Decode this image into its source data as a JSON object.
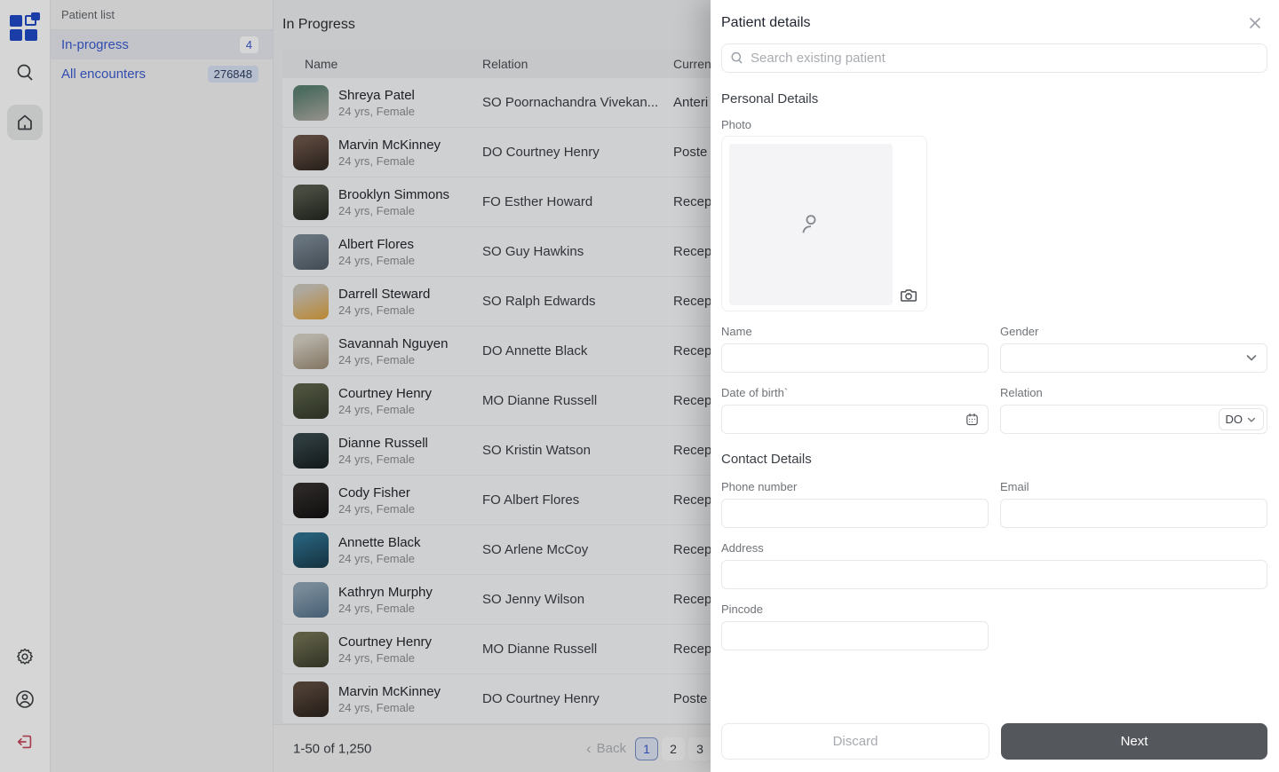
{
  "colors": {
    "accent_blue": "#3b5bd0",
    "logo_blue": "#2149c8",
    "logout_red": "#c9475e",
    "next_button_bg": "#54575b",
    "badge_blue_bg": "#dbe4f7"
  },
  "sidebar": {
    "icons": [
      "app-logo",
      "search-icon",
      "home-icon",
      "gear-icon",
      "profile-icon",
      "logout-icon"
    ],
    "active_icon": "home-icon"
  },
  "panel": {
    "title": "Patient list",
    "items": [
      {
        "label": "In-progress",
        "badge": "4",
        "active": true
      },
      {
        "label": "All encounters",
        "badge": "276848",
        "active": false
      }
    ]
  },
  "main": {
    "title": "In Progress",
    "table": {
      "columns": [
        "Name",
        "Relation",
        "Curren"
      ],
      "rows": [
        {
          "name": "Shreya Patel",
          "meta": "24 yrs, Female",
          "relation": "SO Poornachandra Vivekan...",
          "status": "Anteri",
          "avatar": [
            "#5e8274",
            "#b4afa8"
          ]
        },
        {
          "name": "Marvin McKinney",
          "meta": "24 yrs, Female",
          "relation": "DO  Courtney Henry",
          "status": "Poste",
          "avatar": [
            "#6b5448",
            "#2e2620"
          ]
        },
        {
          "name": "Brooklyn Simmons",
          "meta": "24 yrs, Female",
          "relation": "FO Esther Howard",
          "status": "Recep",
          "avatar": [
            "#565b4d",
            "#23251f"
          ]
        },
        {
          "name": "Albert Flores",
          "meta": "24 yrs, Female",
          "relation": "SO Guy Hawkins",
          "status": "Recep",
          "avatar": [
            "#7a8894",
            "#4f5a64"
          ]
        },
        {
          "name": "Darrell Steward",
          "meta": "24 yrs, Female",
          "relation": "SO Ralph Edwards",
          "status": "Recep",
          "avatar": [
            "#cfc9bd",
            "#dfa23c"
          ]
        },
        {
          "name": "Savannah Nguyen",
          "meta": "24 yrs, Female",
          "relation": "DO Annette Black",
          "status": "Recep",
          "avatar": [
            "#d8d2c6",
            "#9b8b74"
          ]
        },
        {
          "name": "Courtney Henry",
          "meta": "24 yrs, Female",
          "relation": "MO Dianne Russell",
          "status": "Recep",
          "avatar": [
            "#5a6148",
            "#32382a"
          ]
        },
        {
          "name": "Dianne Russell",
          "meta": "24 yrs, Female",
          "relation": "SO Kristin Watson",
          "status": "Recep",
          "avatar": [
            "#37474a",
            "#161d1f"
          ]
        },
        {
          "name": "Cody Fisher",
          "meta": "24 yrs, Female",
          "relation": "FO Albert Flores",
          "status": "Recep",
          "avatar": [
            "#332f2e",
            "#121010"
          ]
        },
        {
          "name": "Annette Black",
          "meta": "24 yrs, Female",
          "relation": "SO Arlene McCoy",
          "status": "Recep",
          "avatar": [
            "#2e6f8e",
            "#1a3b4a"
          ]
        },
        {
          "name": "Kathryn Murphy",
          "meta": "24 yrs, Female",
          "relation": "SO Jenny Wilson",
          "status": "Recep",
          "avatar": [
            "#8fa5b5",
            "#54708a"
          ]
        },
        {
          "name": "Courtney Henry",
          "meta": "24 yrs, Female",
          "relation": "MO Dianne Russell",
          "status": "Recep",
          "avatar": [
            "#6f6f52",
            "#3a3c2c"
          ]
        },
        {
          "name": "Marvin McKinney",
          "meta": "24 yrs, Female",
          "relation": "DO  Courtney Henry",
          "status": "Poste",
          "avatar": [
            "#5c4a3e",
            "#2a221c"
          ]
        }
      ]
    },
    "pagination": {
      "summary": "1-50 of 1,250",
      "back_chevron": "‹",
      "back_label": "Back",
      "pages": [
        "1",
        "2",
        "3"
      ],
      "active_page": "1"
    }
  },
  "drawer": {
    "title": "Patient details",
    "search_placeholder": "Search existing patient",
    "personal": {
      "heading": "Personal Details",
      "photo_label": "Photo",
      "name_label": "Name",
      "gender_label": "Gender",
      "dob_label": "Date of birth`",
      "relation_label": "Relation",
      "relation_value": "DO"
    },
    "contact": {
      "heading": "Contact Details",
      "phone_label": "Phone number",
      "email_label": "Email",
      "address_label": "Address",
      "pincode_label": "Pincode"
    },
    "footer": {
      "discard_label": "Discard",
      "next_label": "Next"
    }
  }
}
